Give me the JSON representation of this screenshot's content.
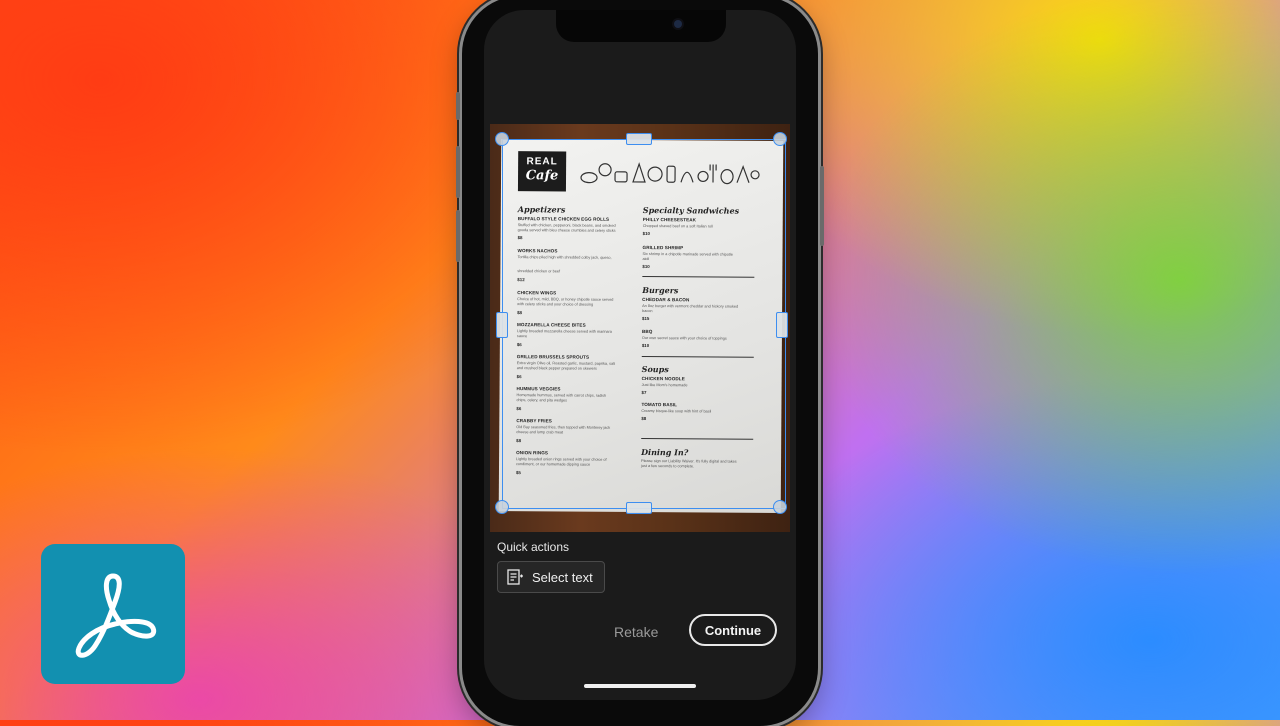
{
  "app": {
    "name": "Adobe Acrobat",
    "logo_icon": "acrobat-logo-icon",
    "brand_color": "#1290b0"
  },
  "scan": {
    "document": {
      "brand_line1": "REAL",
      "brand_line2": "Cafe",
      "left_column": {
        "heading": "Appetizers",
        "items": [
          {
            "name": "BUFFALO STYLE CHICKEN EGG ROLLS",
            "desc": "Stuffed with chicken, pepperoni, black beans, and smoked",
            "desc2": "gouda served with bleu cheese crumbles and celery sticks",
            "price": "$8"
          },
          {
            "name": "WORKS NACHOS",
            "desc": "Tortilla chips piled high with shredded colby jack, queso,",
            "desc2": "shredded chicken or beef",
            "price": "$12"
          },
          {
            "name": "CHICKEN WINGS",
            "desc": "Choice of hot, mild, BBQ, or honey chipotle sauce served",
            "desc2": "with celery sticks and your choice of dressing",
            "price": "$8"
          },
          {
            "name": "MOZZARELLA CHEESE BITES",
            "desc": "Lightly breaded mozzarella cheese served with marinara",
            "desc2": "sauce",
            "price": "$6"
          },
          {
            "name": "GRILLED BRUSSELS SPROUTS",
            "desc": "Extra virgin Olive oil, Roasted garlic, mustard, paprika, salt",
            "desc2": "and crushed black pepper prepared on skewers",
            "price": "$6"
          },
          {
            "name": "HUMMUS VEGGIES",
            "desc": "Homemade hummus, served with carrot chips, radish",
            "desc2": "chips, celery, and pita wedges",
            "price": "$6"
          },
          {
            "name": "CRABBY FRIES",
            "desc": "Old Bay seasoned fries, then topped with Monterey jack",
            "desc2": "cheese and lump crab meat",
            "price": "$8"
          },
          {
            "name": "ONION RINGS",
            "desc": "Lightly breaded onion rings served with your choice of",
            "desc2": "condiment, or our homemade dipping sauce",
            "price": "$5"
          }
        ]
      },
      "right_column": {
        "sections": [
          {
            "heading": "Specialty Sandwiches",
            "items": [
              {
                "name": "PHILLY CHEESESTEAK",
                "desc": "Chopped shaved beef on a soft Italian roll",
                "price": "$10"
              },
              {
                "name": "GRILLED SHRIMP",
                "desc": "Six shrimp in a chipotle marinade served with chipotle",
                "desc2": "aioli",
                "price": "$10"
              }
            ]
          },
          {
            "heading": "Burgers",
            "items": [
              {
                "name": "CHEDDAR & BACON",
                "desc": "An 8oz burger with vermont cheddar and hickory smoked",
                "desc2": "bacon",
                "price": "$15"
              },
              {
                "name": "BBQ",
                "desc": "Our own secret sauce with your choice of toppings",
                "price": "$10"
              }
            ]
          },
          {
            "heading": "Soups",
            "items": [
              {
                "name": "CHICKEN NOODLE",
                "desc": "Just like Mom's homemade",
                "price": "$7"
              },
              {
                "name": "TOMATO BASIL",
                "desc": "Creamy bisque-like soup with hint of basil",
                "price": "$8"
              }
            ]
          },
          {
            "heading": "Dining In?",
            "items": [
              {
                "name": "",
                "desc": "Please sign our Liability Waiver. It's fully digital and takes",
                "desc2": "just a few seconds to complete.",
                "price": ""
              }
            ]
          }
        ]
      }
    }
  },
  "quick_actions": {
    "label": "Quick actions",
    "select_text_label": "Select text",
    "select_text_icon": "select-text-icon"
  },
  "footer": {
    "retake_label": "Retake",
    "continue_label": "Continue"
  }
}
